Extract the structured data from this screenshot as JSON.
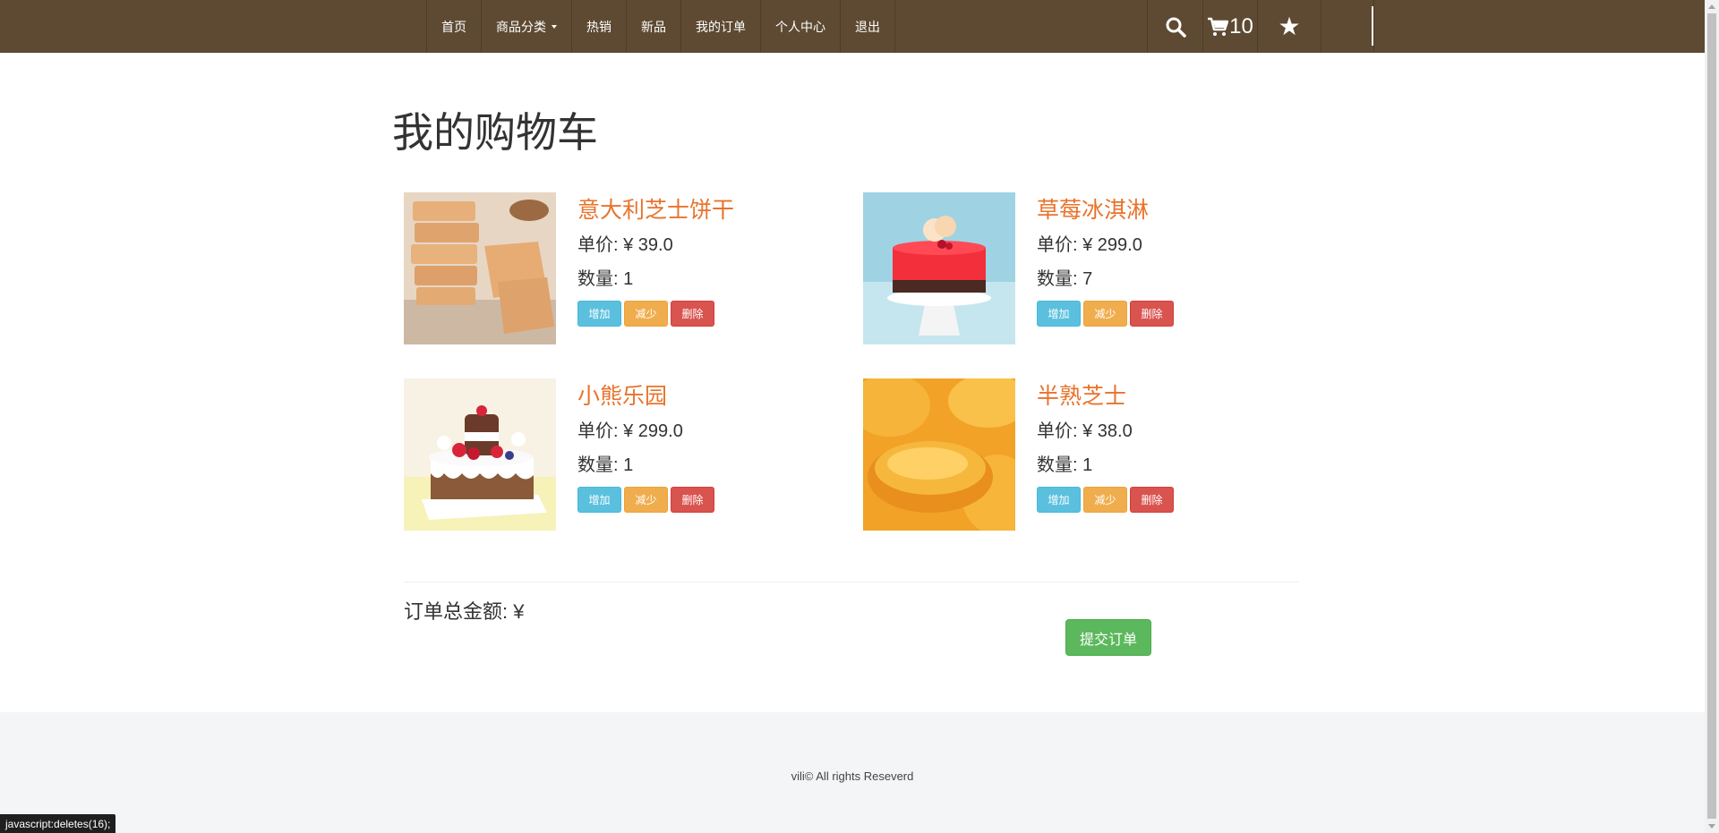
{
  "nav": {
    "items": [
      {
        "label": "首页"
      },
      {
        "label": "商品分类"
      },
      {
        "label": "热销"
      },
      {
        "label": "新品"
      },
      {
        "label": "我的订单"
      },
      {
        "label": "个人中心"
      },
      {
        "label": "退出"
      }
    ],
    "cart_count": "10",
    "icons": [
      "search-icon",
      "cart-icon",
      "star-icon"
    ]
  },
  "page": {
    "title": "我的购物车"
  },
  "cart": {
    "items": [
      {
        "name": "意大利芝士饼干",
        "price": "单价: ¥ 39.0",
        "qty": "数量: 1",
        "add": "增加",
        "dec": "减少",
        "del": "删除"
      },
      {
        "name": "草莓冰淇淋",
        "price": "单价: ¥ 299.0",
        "qty": "数量: 7",
        "add": "增加",
        "dec": "减少",
        "del": "删除"
      },
      {
        "name": "小熊乐园",
        "price": "单价: ¥ 299.0",
        "qty": "数量: 1",
        "add": "增加",
        "dec": "减少",
        "del": "删除"
      },
      {
        "name": "半熟芝士",
        "price": "单价: ¥ 38.0",
        "qty": "数量: 1",
        "add": "增加",
        "dec": "减少",
        "del": "删除"
      }
    ],
    "total_label": "订单总金额: ¥",
    "submit_label": "提交订单"
  },
  "footer": {
    "text": "vili© All rights Reseverd"
  },
  "status_bar": {
    "text": "javascript:deletes(16);"
  },
  "colors": {
    "navbar": "#5e4a32",
    "product_name": "#e8732b",
    "btn_add": "#5bc0de",
    "btn_dec": "#f0ad4e",
    "btn_del": "#d9534f",
    "btn_submit": "#5cb85c",
    "footer_bg": "#f3f5f6"
  }
}
